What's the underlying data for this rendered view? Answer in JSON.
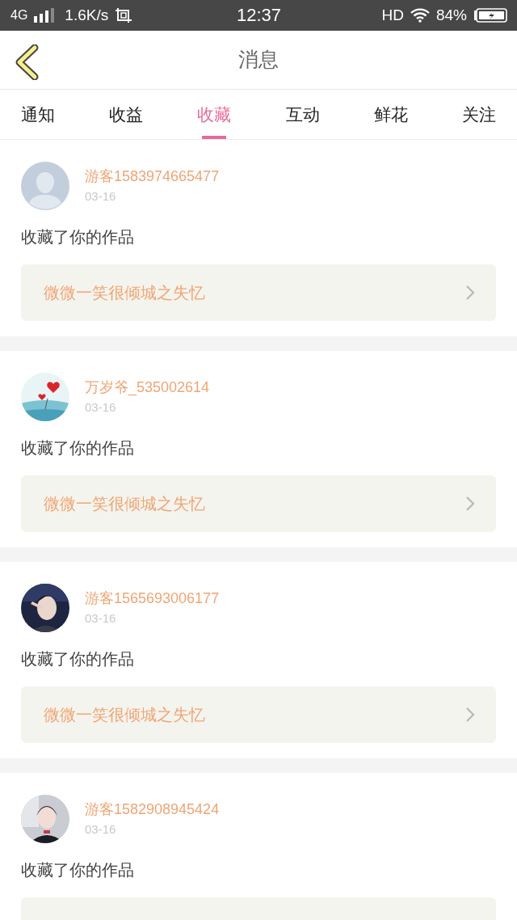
{
  "status_bar": {
    "network": "4G",
    "speed": "1.6K/s",
    "time": "12:37",
    "hd": "HD",
    "battery": "84%"
  },
  "header": {
    "title": "消息"
  },
  "tabs": [
    {
      "label": "通知",
      "selected": false
    },
    {
      "label": "收益",
      "selected": false
    },
    {
      "label": "收藏",
      "selected": true
    },
    {
      "label": "互动",
      "selected": false
    },
    {
      "label": "鲜花",
      "selected": false
    },
    {
      "label": "关注",
      "selected": false
    }
  ],
  "messages": [
    {
      "avatar": {
        "kind": "default"
      },
      "user": "游客1583974665477",
      "date": "03-16",
      "action": "收藏了你的作品",
      "work": "微微一笑很倾城之失忆"
    },
    {
      "user": "万岁爷_535002614",
      "date": "03-16",
      "action": "收藏了你的作品",
      "work": "微微一笑很倾城之失忆"
    },
    {
      "user": "游客1565693006177",
      "date": "03-16",
      "action": "收藏了你的作品",
      "work": "微微一笑很倾城之失忆"
    },
    {
      "user": "游客1582908945424",
      "date": "03-16",
      "action": "收藏了你的作品"
    }
  ]
}
